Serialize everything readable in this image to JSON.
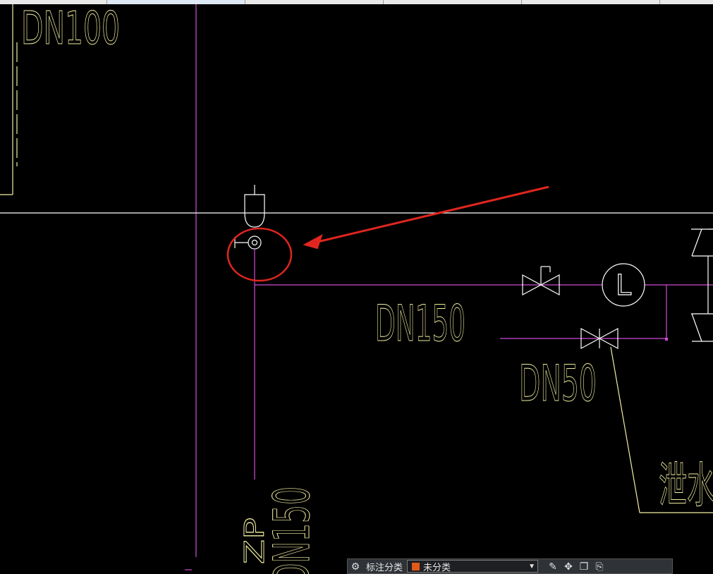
{
  "colors": {
    "background": "#000000",
    "dimension_text": "#f3f0a0",
    "pipe_magenta": "#d04bd8",
    "annotation_red": "#e0261e",
    "line_white": "#ffffff",
    "category_swatch": "#e05a1a"
  },
  "drawing": {
    "labels": {
      "top_left_pipe": "DN100",
      "main_pipe": "DN150",
      "branch_pipe": "DN50",
      "vertical_pipe_tag": "ZP",
      "vertical_pipe_size": "DN150",
      "drain_note": "泄水阀"
    },
    "symbols": {
      "flow_meter": "L"
    }
  },
  "annotation": {
    "highlight": "red-circle-with-arrow"
  },
  "toolbar": {
    "icon_left": "annotation-category-icon",
    "label": "标注分类",
    "select_value": "未分类",
    "icons": [
      "edit-icon",
      "move-icon",
      "copy-icon",
      "paste-icon"
    ]
  }
}
